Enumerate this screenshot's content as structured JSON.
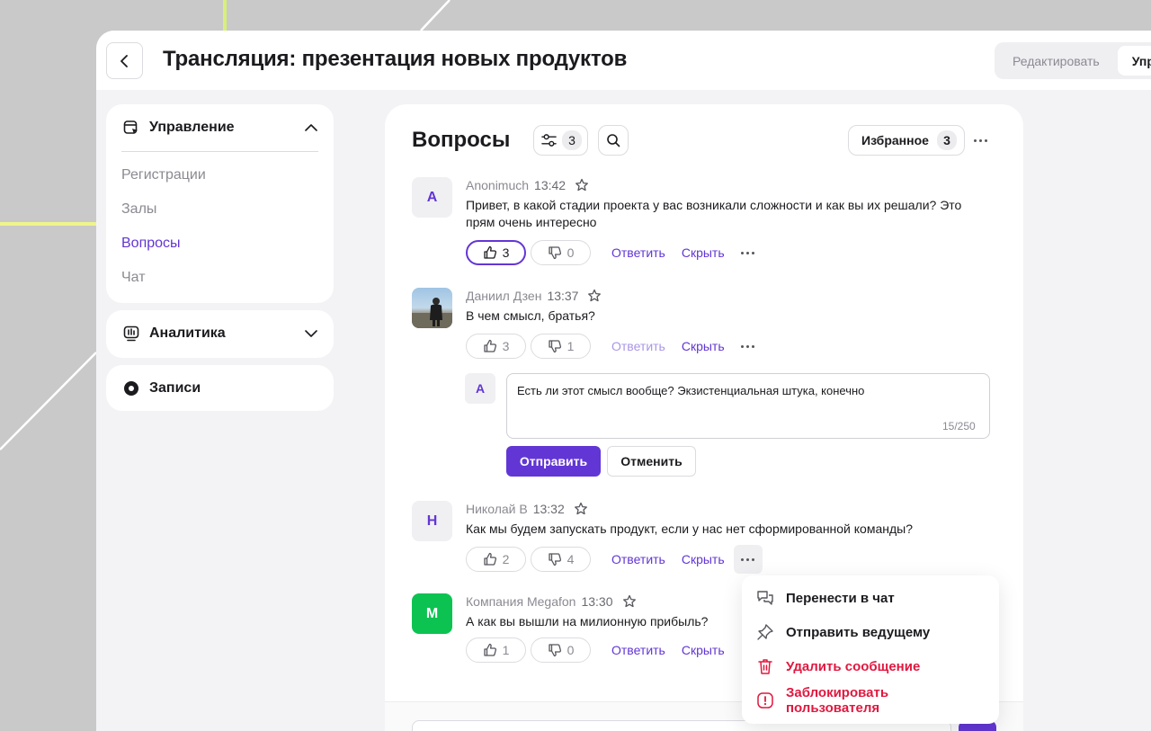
{
  "header": {
    "title": "Трансляция: презентация новых продуктов",
    "modes": {
      "edit": "Редактировать",
      "manage": "Упр"
    }
  },
  "sidebar": {
    "management": {
      "title": "Управление",
      "items": [
        {
          "label": "Регистрации"
        },
        {
          "label": "Залы"
        },
        {
          "label": "Вопросы"
        },
        {
          "label": "Чат"
        }
      ]
    },
    "analytics": {
      "title": "Аналитика"
    },
    "records": {
      "title": "Записи"
    }
  },
  "questions": {
    "title": "Вопросы",
    "filter_count": "3",
    "favorites_label": "Избранное",
    "favorites_count": "3",
    "items": [
      {
        "initial": "A",
        "author": "Anonimuch",
        "time": "13:42",
        "text": "Привет, в какой стадии проекта у вас возникали сложности и как вы их решали? Это прям очень интересно",
        "likes": "3",
        "dislikes": "0",
        "reply": "Ответить",
        "hide": "Скрыть"
      },
      {
        "initial": "",
        "author": "Даниил Дзен",
        "time": "13:37",
        "text": "В чем смысл, братья?",
        "likes": "3",
        "dislikes": "1",
        "reply": "Ответить",
        "hide": "Скрыть"
      },
      {
        "initial": "Н",
        "author": "Николай В",
        "time": "13:32",
        "text": "Как мы будем запускать продукт, если у нас нет сформированной команды?",
        "likes": "2",
        "dislikes": "4",
        "reply": "Ответить",
        "hide": "Скрыть"
      },
      {
        "initial": "M",
        "author": "Компания Megafon",
        "time": "13:30",
        "text": "А как вы вышли на милионную прибыль?",
        "likes": "1",
        "dislikes": "0",
        "reply": "Ответить",
        "hide": "Скрыть"
      }
    ],
    "reply_form": {
      "initial": "A",
      "value": "Есть ли этот смысл вообще? Экзистенциальная штука, конечно",
      "counter": "15/250",
      "submit": "Отправить",
      "cancel": "Отменить"
    }
  },
  "context_menu": {
    "items": [
      {
        "label": "Перенести в чат"
      },
      {
        "label": "Отправить ведущему"
      },
      {
        "label": "Удалить сообщение"
      },
      {
        "label": "Заблокировать пользователя"
      }
    ]
  },
  "colors": {
    "accent": "#6236d4",
    "danger": "#e0183f",
    "green": "#0cc352"
  }
}
